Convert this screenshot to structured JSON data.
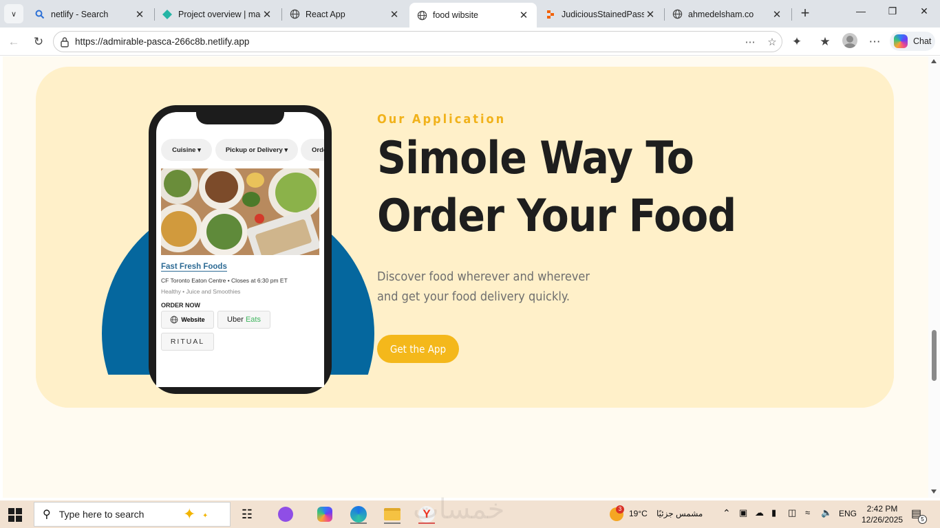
{
  "browser": {
    "tabs": [
      {
        "title": "netlify - Search",
        "icon": "search-icon"
      },
      {
        "title": "Project overview | mage",
        "icon": "netlify-icon"
      },
      {
        "title": "React App",
        "icon": "globe-icon"
      },
      {
        "title": "food wibsite",
        "icon": "globe-icon",
        "active": true
      },
      {
        "title": "JudiciousStainedPasswo",
        "icon": "replit-icon"
      },
      {
        "title": "ahmedelsham.co",
        "icon": "globe-icon"
      }
    ],
    "url": "https://admirable-pasca-266c8b.netlify.app",
    "chat_label": "Chat"
  },
  "page": {
    "eyebrow": "Our Application",
    "headline": "Simole Way To Order Your Food",
    "description": "Discover food wherever and wherever and get your food delivery quickly.",
    "cta_label": "Get the App",
    "colors": {
      "accent": "#f4b81b",
      "card_bg": "#fff0c9",
      "circle": "#05679e",
      "page_bg": "#fffbf1"
    },
    "phone": {
      "chips": [
        "Cuisine",
        "Pickup or Delivery",
        "Orde"
      ],
      "restaurant": "Fast Fresh Foods",
      "address": "CF Toronto Eaton Centre • Closes at 6:30 pm ET",
      "tags": "Healthy  •  Juice and Smoothies",
      "order_now": "ORDER NOW",
      "order_options": [
        "Website",
        "Uber",
        "Eats",
        "RITUAL"
      ]
    }
  },
  "taskbar": {
    "search_placeholder": "Type here to search",
    "weather_temp": "19°C",
    "weather_text": "مشمس جزئيًا",
    "weather_badge": "3",
    "language": "ENG",
    "time": "2:42 PM",
    "date": "12/26/2025",
    "notifications": "5",
    "watermark": "خمسات"
  }
}
